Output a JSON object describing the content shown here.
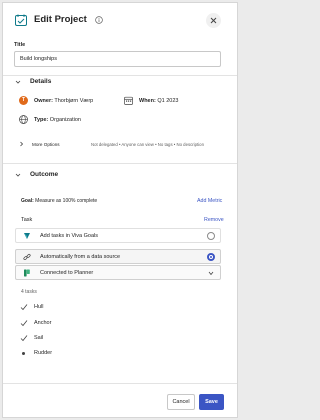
{
  "header": {
    "title": "Edit Project",
    "info_icon": "info-icon",
    "close_icon": "close-icon",
    "app_icon": "project-icon"
  },
  "title_field": {
    "label": "Title",
    "value": "Build longships"
  },
  "details": {
    "heading": "Details",
    "owner_label": "Owner:",
    "owner_name": "Thorbjørn Værp",
    "owner_initial": "T",
    "when_label": "When:",
    "when_value": "Q1 2023",
    "type_label": "Type:",
    "type_value": "Organization",
    "more_options_label": "More Options",
    "more_options_summary": "Not delegated • Anyone can view • No tags • No description"
  },
  "outcome": {
    "heading": "Outcome",
    "goal_label": "Goal:",
    "goal_value": "Measure as 100% complete",
    "add_metric": "Add Metric",
    "task_label": "Task",
    "remove": "Remove",
    "options": [
      {
        "label": "Add tasks in Viva Goals",
        "selected": false,
        "icon": "viva-goals-icon"
      },
      {
        "label": "Automatically from a data source",
        "selected": true,
        "icon": "link-icon"
      }
    ],
    "connection": {
      "label": "Connected to Planner",
      "icon": "planner-icon"
    },
    "tasks_count": "4 tasks",
    "tasks": [
      {
        "name": "Hull",
        "done": true
      },
      {
        "name": "Anchor",
        "done": true
      },
      {
        "name": "Sail",
        "done": true
      },
      {
        "name": "Rudder",
        "done": false
      }
    ]
  },
  "footer": {
    "cancel": "Cancel",
    "save": "Save"
  },
  "colors": {
    "accent": "#3b55c4",
    "avatar": "#e06a1b",
    "planner": "#1f8a5b",
    "viva": "#0f7a8a"
  }
}
